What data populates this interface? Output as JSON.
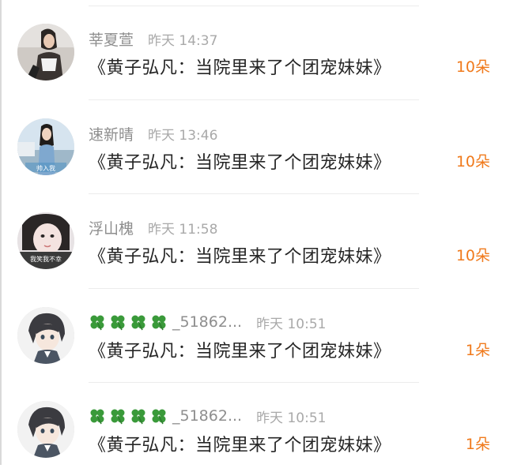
{
  "entries": [
    {
      "avatar_icon": "avatar-photo-girl-dark-hair",
      "clovers": false,
      "username": "莘夏萱",
      "time": "昨天 14:37",
      "message": "《黄子弘凡：当院里来了个团宠妹妹》",
      "count": "10朵"
    },
    {
      "avatar_icon": "avatar-photo-girl-outdoor",
      "avatar_caption": "帅入我",
      "clovers": false,
      "username": "速新晴",
      "time": "昨天 13:46",
      "message": "《黄子弘凡：当院里来了个团宠妹妹》",
      "count": "10朵"
    },
    {
      "avatar_icon": "avatar-photo-girl-closeup",
      "avatar_caption": "我笑我不幸",
      "clovers": false,
      "username": "浮山槐",
      "time": "昨天 11:58",
      "message": "《黄子弘凡：当院里来了个团宠妹妹》",
      "count": "10朵"
    },
    {
      "avatar_icon": "avatar-anime-boy",
      "clovers": true,
      "clover_icon": "four-leaf-clover-icon",
      "username": "_51862...",
      "time": "昨天 10:51",
      "message": "《黄子弘凡：当院里来了个团宠妹妹》",
      "count": "1朵"
    },
    {
      "avatar_icon": "avatar-anime-boy",
      "clovers": true,
      "clover_icon": "four-leaf-clover-icon",
      "username": "_51862...",
      "time": "昨天 10:51",
      "message": "《黄子弘凡：当院里来了个团宠妹妹》",
      "count": "1朵"
    }
  ],
  "colors": {
    "username": "#8e8e8e",
    "time": "#a9a9a9",
    "message": "#262626",
    "count": "#f07a1c",
    "clover": "#3a9a3a"
  }
}
